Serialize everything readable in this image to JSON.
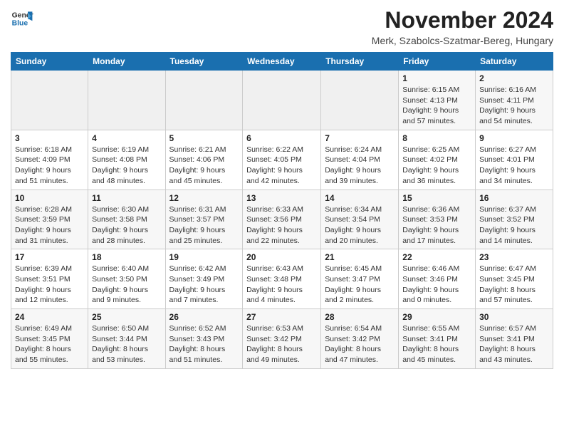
{
  "header": {
    "logo_line1": "General",
    "logo_line2": "Blue",
    "month_title": "November 2024",
    "location": "Merk, Szabolcs-Szatmar-Bereg, Hungary"
  },
  "weekdays": [
    "Sunday",
    "Monday",
    "Tuesday",
    "Wednesday",
    "Thursday",
    "Friday",
    "Saturday"
  ],
  "weeks": [
    [
      {
        "day": "",
        "info": ""
      },
      {
        "day": "",
        "info": ""
      },
      {
        "day": "",
        "info": ""
      },
      {
        "day": "",
        "info": ""
      },
      {
        "day": "",
        "info": ""
      },
      {
        "day": "1",
        "info": "Sunrise: 6:15 AM\nSunset: 4:13 PM\nDaylight: 9 hours\nand 57 minutes."
      },
      {
        "day": "2",
        "info": "Sunrise: 6:16 AM\nSunset: 4:11 PM\nDaylight: 9 hours\nand 54 minutes."
      }
    ],
    [
      {
        "day": "3",
        "info": "Sunrise: 6:18 AM\nSunset: 4:09 PM\nDaylight: 9 hours\nand 51 minutes."
      },
      {
        "day": "4",
        "info": "Sunrise: 6:19 AM\nSunset: 4:08 PM\nDaylight: 9 hours\nand 48 minutes."
      },
      {
        "day": "5",
        "info": "Sunrise: 6:21 AM\nSunset: 4:06 PM\nDaylight: 9 hours\nand 45 minutes."
      },
      {
        "day": "6",
        "info": "Sunrise: 6:22 AM\nSunset: 4:05 PM\nDaylight: 9 hours\nand 42 minutes."
      },
      {
        "day": "7",
        "info": "Sunrise: 6:24 AM\nSunset: 4:04 PM\nDaylight: 9 hours\nand 39 minutes."
      },
      {
        "day": "8",
        "info": "Sunrise: 6:25 AM\nSunset: 4:02 PM\nDaylight: 9 hours\nand 36 minutes."
      },
      {
        "day": "9",
        "info": "Sunrise: 6:27 AM\nSunset: 4:01 PM\nDaylight: 9 hours\nand 34 minutes."
      }
    ],
    [
      {
        "day": "10",
        "info": "Sunrise: 6:28 AM\nSunset: 3:59 PM\nDaylight: 9 hours\nand 31 minutes."
      },
      {
        "day": "11",
        "info": "Sunrise: 6:30 AM\nSunset: 3:58 PM\nDaylight: 9 hours\nand 28 minutes."
      },
      {
        "day": "12",
        "info": "Sunrise: 6:31 AM\nSunset: 3:57 PM\nDaylight: 9 hours\nand 25 minutes."
      },
      {
        "day": "13",
        "info": "Sunrise: 6:33 AM\nSunset: 3:56 PM\nDaylight: 9 hours\nand 22 minutes."
      },
      {
        "day": "14",
        "info": "Sunrise: 6:34 AM\nSunset: 3:54 PM\nDaylight: 9 hours\nand 20 minutes."
      },
      {
        "day": "15",
        "info": "Sunrise: 6:36 AM\nSunset: 3:53 PM\nDaylight: 9 hours\nand 17 minutes."
      },
      {
        "day": "16",
        "info": "Sunrise: 6:37 AM\nSunset: 3:52 PM\nDaylight: 9 hours\nand 14 minutes."
      }
    ],
    [
      {
        "day": "17",
        "info": "Sunrise: 6:39 AM\nSunset: 3:51 PM\nDaylight: 9 hours\nand 12 minutes."
      },
      {
        "day": "18",
        "info": "Sunrise: 6:40 AM\nSunset: 3:50 PM\nDaylight: 9 hours\nand 9 minutes."
      },
      {
        "day": "19",
        "info": "Sunrise: 6:42 AM\nSunset: 3:49 PM\nDaylight: 9 hours\nand 7 minutes."
      },
      {
        "day": "20",
        "info": "Sunrise: 6:43 AM\nSunset: 3:48 PM\nDaylight: 9 hours\nand 4 minutes."
      },
      {
        "day": "21",
        "info": "Sunrise: 6:45 AM\nSunset: 3:47 PM\nDaylight: 9 hours\nand 2 minutes."
      },
      {
        "day": "22",
        "info": "Sunrise: 6:46 AM\nSunset: 3:46 PM\nDaylight: 9 hours\nand 0 minutes."
      },
      {
        "day": "23",
        "info": "Sunrise: 6:47 AM\nSunset: 3:45 PM\nDaylight: 8 hours\nand 57 minutes."
      }
    ],
    [
      {
        "day": "24",
        "info": "Sunrise: 6:49 AM\nSunset: 3:45 PM\nDaylight: 8 hours\nand 55 minutes."
      },
      {
        "day": "25",
        "info": "Sunrise: 6:50 AM\nSunset: 3:44 PM\nDaylight: 8 hours\nand 53 minutes."
      },
      {
        "day": "26",
        "info": "Sunrise: 6:52 AM\nSunset: 3:43 PM\nDaylight: 8 hours\nand 51 minutes."
      },
      {
        "day": "27",
        "info": "Sunrise: 6:53 AM\nSunset: 3:42 PM\nDaylight: 8 hours\nand 49 minutes."
      },
      {
        "day": "28",
        "info": "Sunrise: 6:54 AM\nSunset: 3:42 PM\nDaylight: 8 hours\nand 47 minutes."
      },
      {
        "day": "29",
        "info": "Sunrise: 6:55 AM\nSunset: 3:41 PM\nDaylight: 8 hours\nand 45 minutes."
      },
      {
        "day": "30",
        "info": "Sunrise: 6:57 AM\nSunset: 3:41 PM\nDaylight: 8 hours\nand 43 minutes."
      }
    ]
  ]
}
